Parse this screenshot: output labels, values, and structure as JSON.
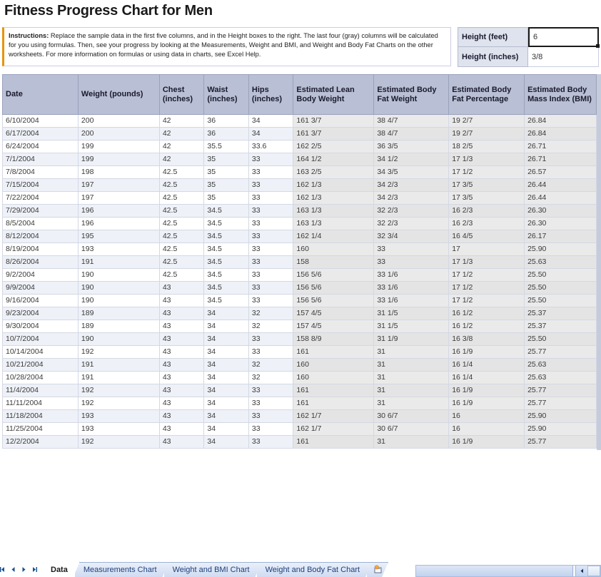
{
  "title": "Fitness Progress Chart for Men",
  "instructions": {
    "label": "Instructions:",
    "body": " Replace the sample data in the first five columns, and in the Height boxes to the right. The last four (gray) columns will be calculated for you using formulas. Then, see your progress by looking at the Measurements, Weight and BMI, and Weight and Body Fat Charts on the other worksheets. For more information on formulas or using data in charts, see Excel Help."
  },
  "height": {
    "feet_label": "Height (feet)",
    "feet_value": "6",
    "inches_label": "Height (inches)",
    "inches_value": "3/8"
  },
  "table": {
    "headers": [
      "Date",
      "Weight (pounds)",
      "Chest (inches)",
      "Waist (inches)",
      "Hips (inches)",
      "Estimated Lean Body Weight",
      "Estimated Body Fat Weight",
      "Estimated Body Fat Percentage",
      "Estimated Body Mass Index (BMI)"
    ],
    "rows": [
      [
        "6/10/2004",
        "200",
        "42",
        "36",
        "34",
        "161 3/7",
        "38 4/7",
        "19 2/7",
        "26.84"
      ],
      [
        "6/17/2004",
        "200",
        "42",
        "36",
        "34",
        "161 3/7",
        "38 4/7",
        "19 2/7",
        "26.84"
      ],
      [
        "6/24/2004",
        "199",
        "42",
        "35.5",
        "33.6",
        "162 2/5",
        "36 3/5",
        "18 2/5",
        "26.71"
      ],
      [
        "7/1/2004",
        "199",
        "42",
        "35",
        "33",
        "164 1/2",
        "34 1/2",
        "17 1/3",
        "26.71"
      ],
      [
        "7/8/2004",
        "198",
        "42.5",
        "35",
        "33",
        "163 2/5",
        "34 3/5",
        "17 1/2",
        "26.57"
      ],
      [
        "7/15/2004",
        "197",
        "42.5",
        "35",
        "33",
        "162 1/3",
        "34 2/3",
        "17 3/5",
        "26.44"
      ],
      [
        "7/22/2004",
        "197",
        "42.5",
        "35",
        "33",
        "162 1/3",
        "34 2/3",
        "17 3/5",
        "26.44"
      ],
      [
        "7/29/2004",
        "196",
        "42.5",
        "34.5",
        "33",
        "163 1/3",
        "32 2/3",
        "16 2/3",
        "26.30"
      ],
      [
        "8/5/2004",
        "196",
        "42.5",
        "34.5",
        "33",
        "163 1/3",
        "32 2/3",
        "16 2/3",
        "26.30"
      ],
      [
        "8/12/2004",
        "195",
        "42.5",
        "34.5",
        "33",
        "162 1/4",
        "32 3/4",
        "16 4/5",
        "26.17"
      ],
      [
        "8/19/2004",
        "193",
        "42.5",
        "34.5",
        "33",
        "160",
        "33",
        "17",
        "25.90"
      ],
      [
        "8/26/2004",
        "191",
        "42.5",
        "34.5",
        "33",
        "158",
        "33",
        "17 1/3",
        "25.63"
      ],
      [
        "9/2/2004",
        "190",
        "42.5",
        "34.5",
        "33",
        "156 5/6",
        "33 1/6",
        "17 1/2",
        "25.50"
      ],
      [
        "9/9/2004",
        "190",
        "43",
        "34.5",
        "33",
        "156 5/6",
        "33 1/6",
        "17 1/2",
        "25.50"
      ],
      [
        "9/16/2004",
        "190",
        "43",
        "34.5",
        "33",
        "156 5/6",
        "33 1/6",
        "17 1/2",
        "25.50"
      ],
      [
        "9/23/2004",
        "189",
        "43",
        "34",
        "32",
        "157 4/5",
        "31 1/5",
        "16 1/2",
        "25.37"
      ],
      [
        "9/30/2004",
        "189",
        "43",
        "34",
        "32",
        "157 4/5",
        "31 1/5",
        "16 1/2",
        "25.37"
      ],
      [
        "10/7/2004",
        "190",
        "43",
        "34",
        "33",
        "158 8/9",
        "31 1/9",
        "16 3/8",
        "25.50"
      ],
      [
        "10/14/2004",
        "192",
        "43",
        "34",
        "33",
        "161",
        "31",
        "16 1/9",
        "25.77"
      ],
      [
        "10/21/2004",
        "191",
        "43",
        "34",
        "32",
        "160",
        "31",
        "16 1/4",
        "25.63"
      ],
      [
        "10/28/2004",
        "191",
        "43",
        "34",
        "32",
        "160",
        "31",
        "16 1/4",
        "25.63"
      ],
      [
        "11/4/2004",
        "192",
        "43",
        "34",
        "33",
        "161",
        "31",
        "16 1/9",
        "25.77"
      ],
      [
        "11/11/2004",
        "192",
        "43",
        "34",
        "33",
        "161",
        "31",
        "16 1/9",
        "25.77"
      ],
      [
        "11/18/2004",
        "193",
        "43",
        "34",
        "33",
        "162 1/7",
        "30 6/7",
        "16",
        "25.90"
      ],
      [
        "11/25/2004",
        "193",
        "43",
        "34",
        "33",
        "162 1/7",
        "30 6/7",
        "16",
        "25.90"
      ],
      [
        "12/2/2004",
        "192",
        "43",
        "34",
        "33",
        "161",
        "31",
        "16 1/9",
        "25.77"
      ]
    ]
  },
  "sheet_tabs": [
    {
      "label": "Data",
      "active": true
    },
    {
      "label": "Measurements Chart",
      "active": false
    },
    {
      "label": "Weight and BMI Chart",
      "active": false
    },
    {
      "label": "Weight and Body Fat Chart",
      "active": false
    }
  ],
  "colors": {
    "header_bg": "#b9bfd4",
    "row_alt_bg": "#eef1f7",
    "calc_bg": "#eaeaea",
    "accent_orange": "#e8920c",
    "tab_text": "#1f3f7a"
  }
}
